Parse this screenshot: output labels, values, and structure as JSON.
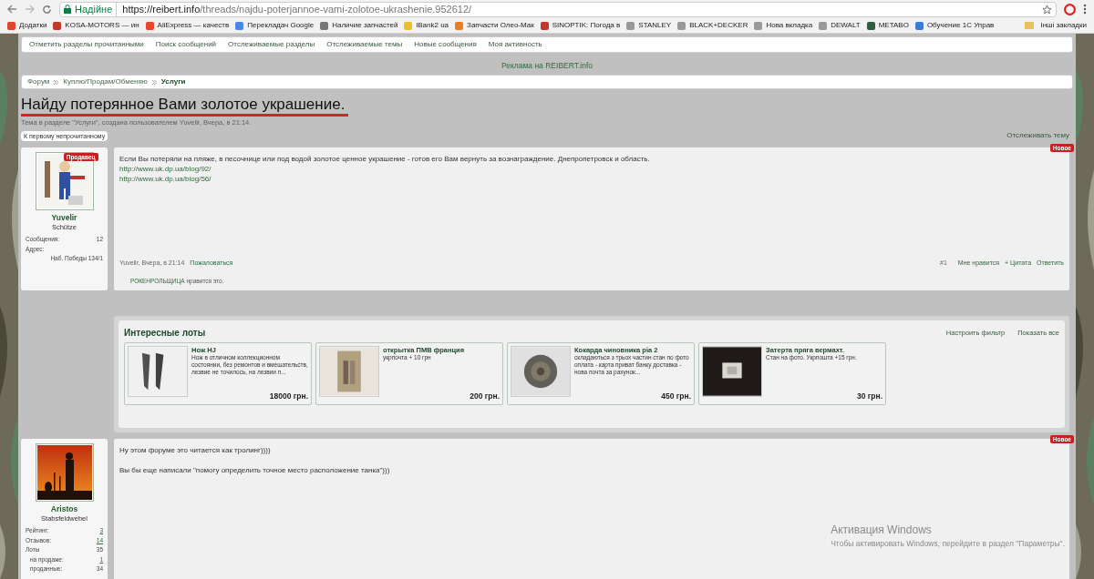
{
  "browser": {
    "secure_label": "Надійне",
    "url_host": "https://reibert.info",
    "url_path": "/threads/najdu-poterjannoe-vami-zolotoe-ukrashenie.952612/",
    "bookmarks": [
      {
        "label": "Додатки",
        "color": "#e0462f"
      },
      {
        "label": "KOSA-MOTORS — ин",
        "color": "#c0392b"
      },
      {
        "label": "AliExpress — качеств",
        "color": "#e8452c"
      },
      {
        "label": "Перекладач Google",
        "color": "#4a86e8"
      },
      {
        "label": "Наличие запчастей",
        "color": "#777777"
      },
      {
        "label": "iBank2 ua",
        "color": "#e8c02c"
      },
      {
        "label": "Запчасти Олео-Мак",
        "color": "#e67e22"
      },
      {
        "label": "SINOPTIK: Погода в",
        "color": "#c0392b"
      },
      {
        "label": "STANLEY",
        "color": "#999999"
      },
      {
        "label": "BLACK+DECKER",
        "color": "#999999"
      },
      {
        "label": "Нова вкладка",
        "color": "#999999"
      },
      {
        "label": "DEWALT",
        "color": "#999999"
      },
      {
        "label": "METABO",
        "color": "#2e5e3e"
      },
      {
        "label": "Обучение 1С Управ",
        "color": "#3a7bd5"
      }
    ],
    "other_bookmarks": "Інші закладки"
  },
  "nav_links": [
    "Отметить разделы прочитанными",
    "Поиск сообщений",
    "Отслеживаемые разделы",
    "Отслеживаемые темы",
    "Новые сообщения",
    "Моя активность"
  ],
  "ad_text": "Реклама на REIBERT.info",
  "breadcrumb": [
    {
      "label": "Форум",
      "current": false
    },
    {
      "label": "Куплю/Продам/Обменяю",
      "current": false
    },
    {
      "label": "Услуги",
      "current": true
    }
  ],
  "thread": {
    "title": "Найду потерянное Вами золотое украшение.",
    "subtitle": "Тема в разделе \"Услуги\", создана пользователем Yuvelir, Вчера, в 21:14.",
    "first_unread": "К первому непрочитанному",
    "watch": "Отслеживать тему"
  },
  "posts": [
    {
      "author": "Yuvelir",
      "rank": "Schütze",
      "badge": "Продавец",
      "new_label": "Новое",
      "stats": [
        {
          "label": "Сообщения:",
          "value": "12",
          "kind": "plain"
        },
        {
          "label": "Адрес:",
          "kind": "plain"
        }
      ],
      "address": "Наб. Победы 134/1",
      "body": [
        {
          "kind": "text",
          "text": "Если Вы потеряли на пляже, в песочнице или под водой золотое ценное украшение - готов его Вам вернуть за вознаграждение. Днепропетровск и область."
        },
        {
          "kind": "link",
          "text": "http://www.uk.dp.ua/blog/92/"
        },
        {
          "kind": "link",
          "text": "http://www.uk.dp.ua/blog/56/"
        }
      ],
      "footer": {
        "meta": "Yuvelir, Вчера, в 21:14",
        "report": "Пожаловаться",
        "number": "#1",
        "actions": [
          "Мне нравится",
          "+ Цитата",
          "Ответить"
        ]
      },
      "likes": {
        "user": "РОКЕНРОЛЬЩИЦА",
        "text": "нравится это."
      }
    },
    {
      "author": "Aristos",
      "rank": "Stabsfeldwebel",
      "new_label": "Новое",
      "stats": [
        {
          "label": "Рейтинг:",
          "value": "3",
          "kind": "link"
        },
        {
          "label": "Отзывов:",
          "value": "14",
          "kind": "link"
        },
        {
          "label": "Лоты",
          "value": "35",
          "kind": "plain"
        },
        {
          "label": "на продаже:",
          "value": "1",
          "kind": "sub_link"
        },
        {
          "label": "проданные:",
          "value": "34",
          "kind": "sub"
        }
      ],
      "body": [
        {
          "kind": "text",
          "text": "Ну этом форуме это читается как тролинг))))"
        },
        {
          "kind": "blank"
        },
        {
          "kind": "text",
          "text": "Вы бы еще написали \"помогу определить точное место расположение танка\")))"
        }
      ]
    }
  ],
  "lots": {
    "title": "Интересные лоты",
    "links": [
      "Настроить фильтр",
      "Показать все"
    ],
    "items": [
      {
        "title": "Нож HJ",
        "description": "Нож в отличном коллекционном состоянии, без ремонтов и вмешательств, лезвие не точилось, на лезвии п...",
        "price": "18000 грн."
      },
      {
        "title": "открытка ПМВ франция",
        "description": "укрпочта + 10 грн",
        "price": "200 грн."
      },
      {
        "title": "Кокарда чиновника ріа 2",
        "description": "складаються з трьох частин стан по фото оплата - карта приват банку доставка - нова почта за рахунок...",
        "price": "450 грн."
      },
      {
        "title": "Затерта пряга вермахт.",
        "description": "Стан на фото. Укрпошта +15 грн.",
        "price": "30 грн."
      }
    ]
  },
  "os_notice": {
    "title": "Активация Windows",
    "text": "Чтобы активировать Windows, перейдите в раздел \"Параметры\"."
  }
}
